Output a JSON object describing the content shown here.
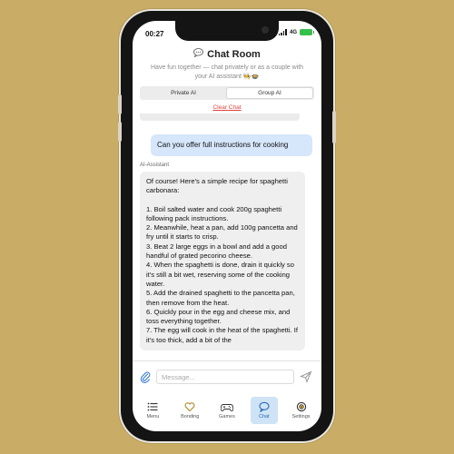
{
  "status": {
    "time": "00:27",
    "network": "4G"
  },
  "header": {
    "title": "Chat Room",
    "title_icon": "speech-bubble-icon",
    "subtitle": "Have fun together — chat privately or as a couple with your AI assistant 🧑‍🍳🍲"
  },
  "tabs": [
    {
      "label": "Private AI",
      "active": false
    },
    {
      "label": "Group AI",
      "active": true
    }
  ],
  "clear_label": "Clear Chat",
  "messages": {
    "user": "Can you offer full instructions for cooking",
    "ai_label": "AI-Assistant",
    "ai_intro": "Of course! Here's a simple recipe for spaghetti carbonara:",
    "ai_steps": [
      "1. Boil salted water and cook 200g spaghetti following pack instructions.",
      "2. Meanwhile, heat a pan, add 100g pancetta and fry until it starts to crisp.",
      "3. Beat 2 large eggs in a bowl and add a good handful of grated pecorino cheese.",
      "4. When the spaghetti is done, drain it quickly so it's still a bit wet, reserving some of the cooking water.",
      "5. Add the drained spaghetti to the pancetta pan, then remove from the heat.",
      "6. Quickly pour in the egg and cheese mix, and toss everything together.",
      "7. The egg will cook in the heat of the spaghetti. If it's too thick, add a bit of the"
    ]
  },
  "composer": {
    "placeholder": "Message..."
  },
  "nav": [
    {
      "label": "Menu",
      "icon": "menu-icon",
      "active": false
    },
    {
      "label": "Bonding",
      "icon": "heart-icon",
      "active": false
    },
    {
      "label": "Games",
      "icon": "gamepad-icon",
      "active": false
    },
    {
      "label": "Chat",
      "icon": "chat-icon",
      "active": true
    },
    {
      "label": "Settings",
      "icon": "settings-icon",
      "active": false
    }
  ],
  "colors": {
    "background": "#c9ad66",
    "user_bubble": "#d6e6fb",
    "ai_bubble": "#efefef",
    "clear": "#e04343",
    "nav_active": "#cfe3f6"
  }
}
